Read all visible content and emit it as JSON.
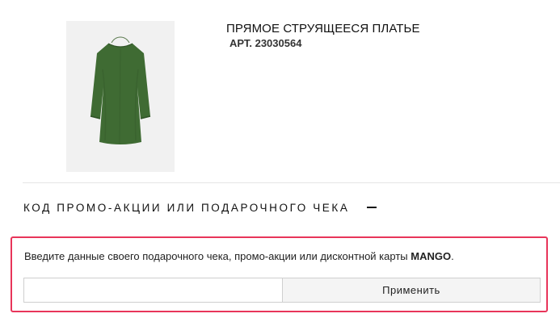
{
  "product": {
    "image_icon": "dress-product-image",
    "title": "ПРЯМОЕ СТРУЯЩЕЕСЯ ПЛАТЬЕ",
    "sku": "АРТ. 23030564",
    "dress_color": "#3f6b33"
  },
  "promo": {
    "section_title": "КОД ПРОМО-АКЦИИ ИЛИ ПОДАРОЧНОГО ЧЕКА",
    "collapse_icon": "minus-icon",
    "instructions_text": "Введите данные своего подарочного чека, промо-акции или дисконтной карты ",
    "instructions_brand": "MANGO",
    "instructions_end": ".",
    "input_value": "",
    "input_placeholder": "",
    "apply_label": "Применить",
    "highlight_color": "#e8355a"
  }
}
